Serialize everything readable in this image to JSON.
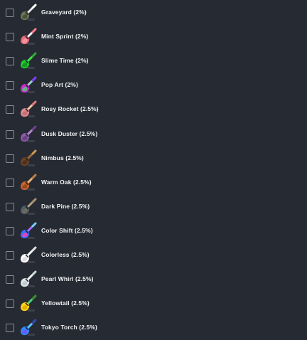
{
  "items": [
    {
      "label": "Graveyard (2%)",
      "icon": "graveyard-broom-icon",
      "head": "#6f7457",
      "head2": "#3f4a2f",
      "stick": "#e8e8e8",
      "handle": "#ffffff"
    },
    {
      "label": "Mint Sprint (2%)",
      "icon": "mint-sprint-broom-icon",
      "head": "#e46d7a",
      "head2": "#ff9aa6",
      "stick": "#f5f5f5",
      "handle": "#ff7a8a"
    },
    {
      "label": "Slime Time (2%)",
      "icon": "slime-time-broom-icon",
      "head": "#22c833",
      "head2": "#0f8d1f",
      "stick": "#45e04c",
      "handle": "#2aa836"
    },
    {
      "label": "Pop Art (2%)",
      "icon": "pop-art-broom-icon",
      "head": "#cc2ecf",
      "head2": "#48d36b",
      "stick": "#9fd2c8",
      "handle": "#7d3cff"
    },
    {
      "label": "Rosy Rocket (2.5%)",
      "icon": "rosy-rocket-broom-icon",
      "head": "#e08b91",
      "head2": "#bd6a72",
      "stick": "#f2c7a1",
      "handle": "#e07780"
    },
    {
      "label": "Dusk Duster (2.5%)",
      "icon": "dusk-duster-broom-icon",
      "head": "#8c5ca8",
      "head2": "#5d3c77",
      "stick": "#b68ac9",
      "handle": "#6b3c91"
    },
    {
      "label": "Nimbus (2.5%)",
      "icon": "nimbus-broom-icon",
      "head": "#6b4323",
      "head2": "#4a2c17",
      "stick": "#9f6a39",
      "handle": "#d29a55"
    },
    {
      "label": "Warm Oak (2.5%)",
      "icon": "warm-oak-broom-icon",
      "head": "#c7652e",
      "head2": "#8f4319",
      "stick": "#e8b27b",
      "handle": "#bd7b42"
    },
    {
      "label": "Dark Pine (2.5%)",
      "icon": "dark-pine-broom-icon",
      "head": "#4d5f67",
      "head2": "#7a6a5b",
      "stick": "#b2a17f",
      "handle": "#a8926b"
    },
    {
      "label": "Color Shift (2.5%)",
      "icon": "color-shift-broom-icon",
      "head": "#3b6dff",
      "head2": "#ff3ea9",
      "stick": "#a86cff",
      "handle": "#6bd5ff"
    },
    {
      "label": "Colorless (2.5%)",
      "icon": "colorless-broom-icon",
      "head": "#ffffff",
      "head2": "#d9d9d9",
      "stick": "#ffffff",
      "handle": "#e0e0e0"
    },
    {
      "label": "Pearl Whirl (2.5%)",
      "icon": "pearl-whirl-broom-icon",
      "head": "#dfe8e8",
      "head2": "#b7c5c8",
      "stick": "#eef4f4",
      "handle": "#c8d7d9"
    },
    {
      "label": "Yellowtail (2.5%)",
      "icon": "yellowtail-broom-icon",
      "head": "#ffd318",
      "head2": "#d6a900",
      "stick": "#4cd47a",
      "handle": "#3f8d2c"
    },
    {
      "label": "Tokyo Torch (2.5%)",
      "icon": "tokyo-torch-broom-icon",
      "head": "#2f8bff",
      "head2": "#7a4cff",
      "stick": "#5bc7ff",
      "handle": "#2c4aa8"
    }
  ]
}
